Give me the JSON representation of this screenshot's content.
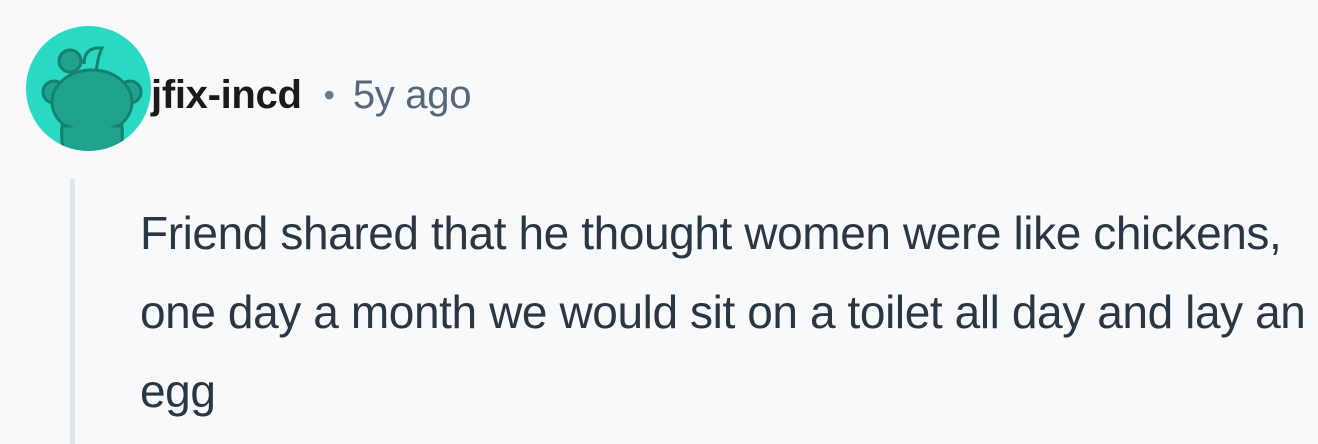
{
  "comment": {
    "author": "jfix-incd",
    "separator": "•",
    "timestamp": "5y ago",
    "body": "Friend shared that he thought women were like chickens, one day a month we would sit on a toilet all day and lay an egg",
    "avatar_icon": "reddit-snoo-icon",
    "colors": {
      "avatar_bg": "#2ad9c4",
      "avatar_figure": "#1fa38f",
      "background": "#f8f9fb",
      "thread_line": "#dfe5ea"
    }
  }
}
